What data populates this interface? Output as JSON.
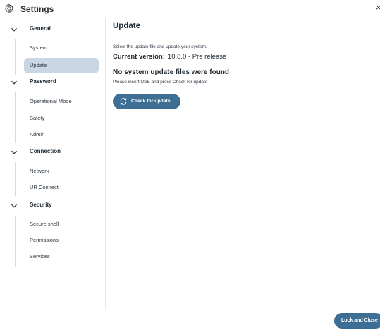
{
  "window": {
    "title": "Settings",
    "close_glyph": "×"
  },
  "sidebar": {
    "groups": [
      {
        "label": "General",
        "icon": "chevron-down-icon",
        "items": [
          {
            "label": "System"
          },
          {
            "label": "Update",
            "selected": true
          }
        ]
      },
      {
        "label": "Password",
        "icon": "chevron-down-icon",
        "items": [
          {
            "label": "Operational Mode"
          },
          {
            "label": "Safety"
          },
          {
            "label": "Admin"
          }
        ]
      },
      {
        "label": "Connection",
        "icon": "chevron-down-icon",
        "items": [
          {
            "label": "Network"
          },
          {
            "label": "UR Connect"
          }
        ]
      },
      {
        "label": "Security",
        "icon": "chevron-down-icon",
        "items": [
          {
            "label": "Secure shell"
          },
          {
            "label": "Permissions"
          },
          {
            "label": "Services"
          }
        ]
      }
    ]
  },
  "main": {
    "title": "Update",
    "instruction": "Select the update file and update your system.",
    "current_version_label": "Current version:",
    "current_version_value": "10.8.0 - Pre release",
    "no_files_heading": "No system update files were found",
    "hint": "Please insert USB and press Check for update",
    "check_button_label": "Check for update"
  },
  "footer": {
    "lock_button_label": "Lock and Close"
  },
  "colors": {
    "accent": "#3d6e93",
    "selected_bg": "#c9d6e3",
    "divider": "#e4e6e8"
  },
  "icons": {
    "app": "gear-icon",
    "check": "refresh-icon"
  }
}
